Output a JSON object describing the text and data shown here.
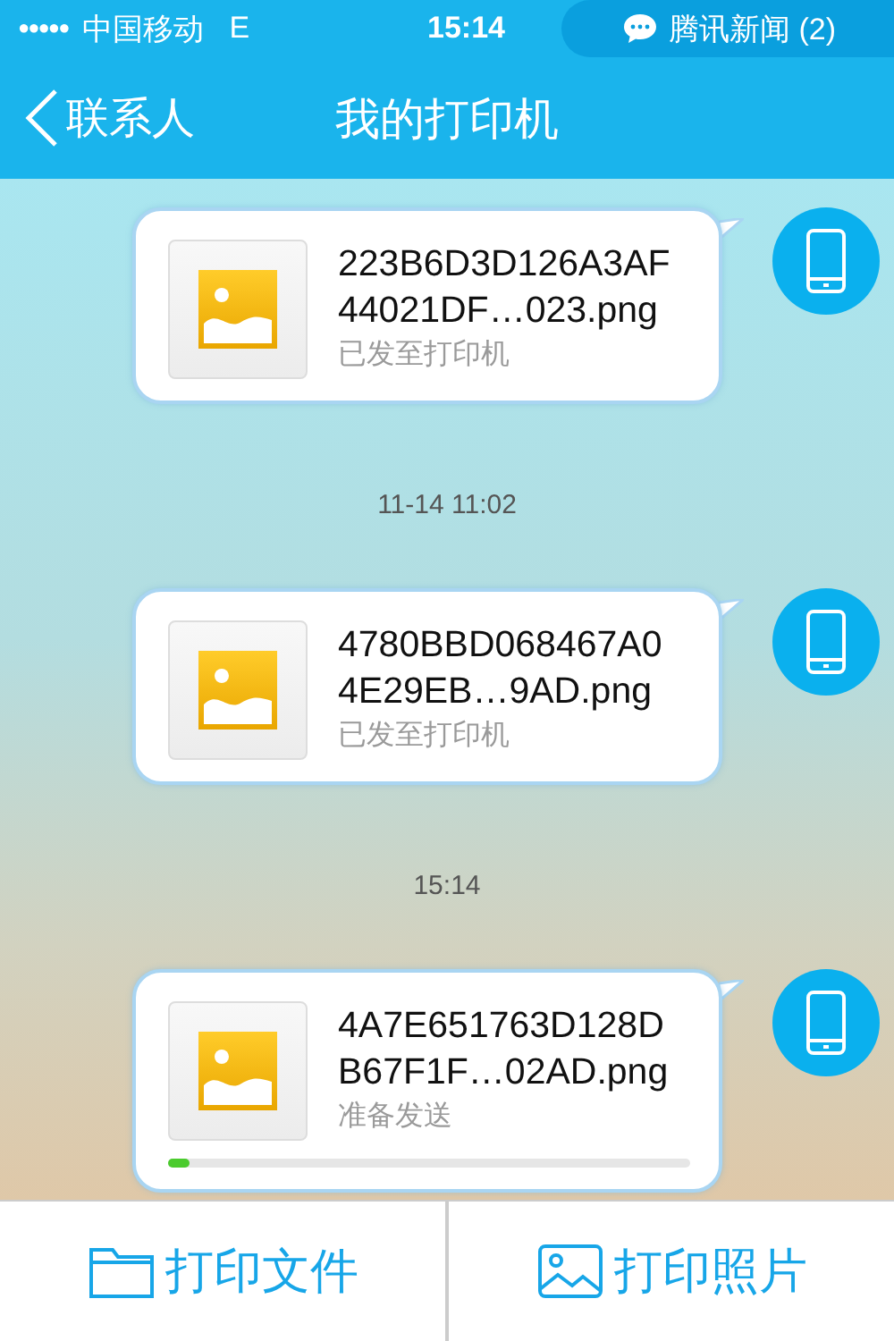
{
  "status_bar": {
    "signal_dots": "●●●●●",
    "carrier": "中国移动",
    "network": "E",
    "time": "15:14",
    "notification": "腾讯新闻 (2)"
  },
  "nav": {
    "back": "联系人",
    "title": "我的打印机"
  },
  "thread": [
    {
      "kind": "message",
      "file": "223B6D3D126A3AF44021DF…023.png",
      "status": "已发至打印机"
    },
    {
      "kind": "time",
      "text": "11-14 11:02"
    },
    {
      "kind": "message",
      "file": "4780BBD068467A04E29EB…9AD.png",
      "status": "已发至打印机"
    },
    {
      "kind": "time",
      "text": "15:14"
    },
    {
      "kind": "message",
      "file": "4A7E651763D128DB67F1F…02AD.png",
      "status": "准备发送",
      "level": 0.04
    }
  ],
  "actions": [
    {
      "kind": "file",
      "label": "打印文件"
    },
    {
      "kind": "photo",
      "label": "打印照片"
    }
  ]
}
